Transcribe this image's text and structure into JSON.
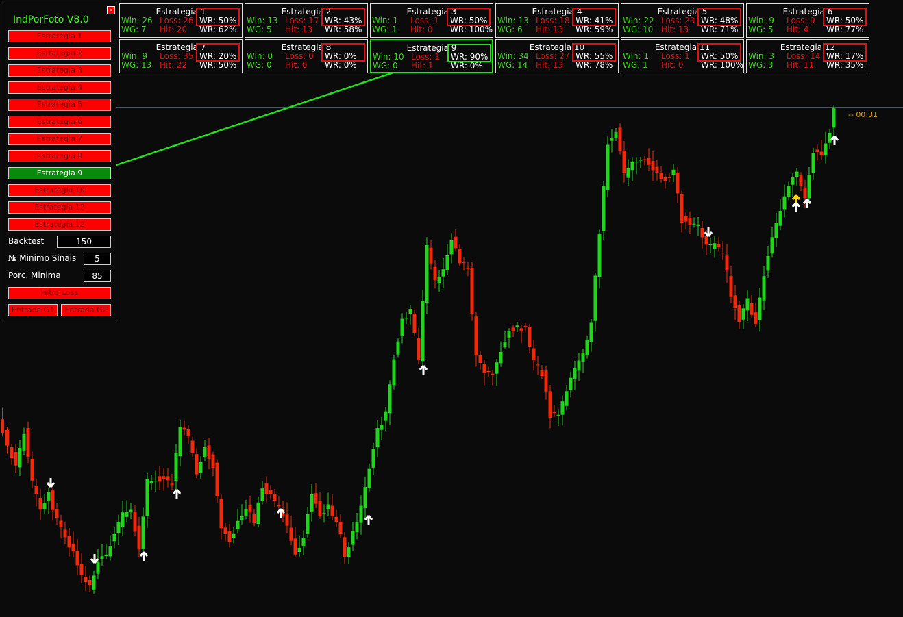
{
  "colors": {
    "bull": "#22d51c",
    "bear": "#f2280a",
    "signal_up": "#ffffff",
    "signal_yellow": "#ffd700",
    "highlight_arrow": "#22e01a",
    "wr_box": "#e01010"
  },
  "panel": {
    "title": "IndPorFoto V8.0",
    "close_icon": "close-icon",
    "strategy_buttons": [
      "Estrategia 1",
      "Estrategia 2",
      "Estrategia 3",
      "Estrategia 4",
      "Estrategia 5",
      "Estrategia 6",
      "Estrategia 7",
      "Estrategia 8",
      "Estrategia 9",
      "Estrategia 10",
      "Estrategia 12",
      "Estrategia 12"
    ],
    "active_strategy": "Estrategia 9",
    "backtest": {
      "label": "Backtest",
      "value": "150"
    },
    "min_signals": {
      "label": "№ Minimo Sinais",
      "value": "5"
    },
    "min_percent": {
      "label": "Porc. Minima",
      "value": "85"
    },
    "filtro_loss": "Filtro Loss",
    "entrada_g1": "Entrada G1",
    "entrada_g2": "Entrada G2"
  },
  "stats": [
    {
      "title": "Estrategia 1",
      "win": "Win: 26",
      "loss": "Loss: 26",
      "wr": "WR: 50%",
      "wg": "WG: 7",
      "hit": "Hit: 20",
      "wr2": "WR: 62%"
    },
    {
      "title": "Estrategia 2",
      "win": "Win: 13",
      "loss": "Loss: 17",
      "wr": "WR: 43%",
      "wg": "WG: 5",
      "hit": "Hit: 13",
      "wr2": "WR: 58%"
    },
    {
      "title": "Estrategia 3",
      "win": "Win: 1",
      "loss": "Loss: 1",
      "wr": "WR: 50%",
      "wg": "WG: 1",
      "hit": "Hit: 0",
      "wr2": "WR: 100%"
    },
    {
      "title": "Estrategia 4",
      "win": "Win: 13",
      "loss": "Loss: 18",
      "wr": "WR: 41%",
      "wg": "WG: 6",
      "hit": "Hit: 13",
      "wr2": "WR: 59%"
    },
    {
      "title": "Estrategia 5",
      "win": "Win: 22",
      "loss": "Loss: 23",
      "wr": "WR: 48%",
      "wg": "WG: 10",
      "hit": "Hit: 13",
      "wr2": "WR: 71%"
    },
    {
      "title": "Estrategia 6",
      "win": "Win: 9",
      "loss": "Loss: 9",
      "wr": "WR: 50%",
      "wg": "WG: 5",
      "hit": "Hit: 4",
      "wr2": "WR: 77%"
    },
    {
      "title": "Estrategia 7",
      "win": "Win: 9",
      "loss": "Loss: 35",
      "wr": "WR: 20%",
      "wg": "WG: 13",
      "hit": "Hit: 22",
      "wr2": "WR: 50%"
    },
    {
      "title": "Estrategia 8",
      "win": "Win: 0",
      "loss": "Loss: 0",
      "wr": "WR: 0%",
      "wg": "WG: 0",
      "hit": "Hit: 0",
      "wr2": "WR: 0%"
    },
    {
      "title": "Estrategia 9",
      "win": "Win: 10",
      "loss": "Loss: 1",
      "wr": "WR: 90%",
      "wg": "WG: 0",
      "hit": "Hit: 1",
      "wr2": "WR: 0%"
    },
    {
      "title": "Estrategia 10",
      "win": "Win: 34",
      "loss": "Loss: 27",
      "wr": "WR: 55%",
      "wg": "WG: 14",
      "hit": "Hit: 13",
      "wr2": "WR: 78%"
    },
    {
      "title": "Estrategia 11",
      "win": "Win: 1",
      "loss": "Loss: 1",
      "wr": "WR: 50%",
      "wg": "WG: 1",
      "hit": "Hit: 0",
      "wr2": "WR: 100%"
    },
    {
      "title": "Estrategia 12",
      "win": "Win: 3",
      "loss": "Loss: 14",
      "wr": "WR: 17%",
      "wg": "WG: 3",
      "hit": "Hit: 11",
      "wr2": "WR: 35%"
    }
  ],
  "timer": "-- 00:31",
  "signal_icons": [
    "arrow-up-icon",
    "arrow-down-icon"
  ]
}
